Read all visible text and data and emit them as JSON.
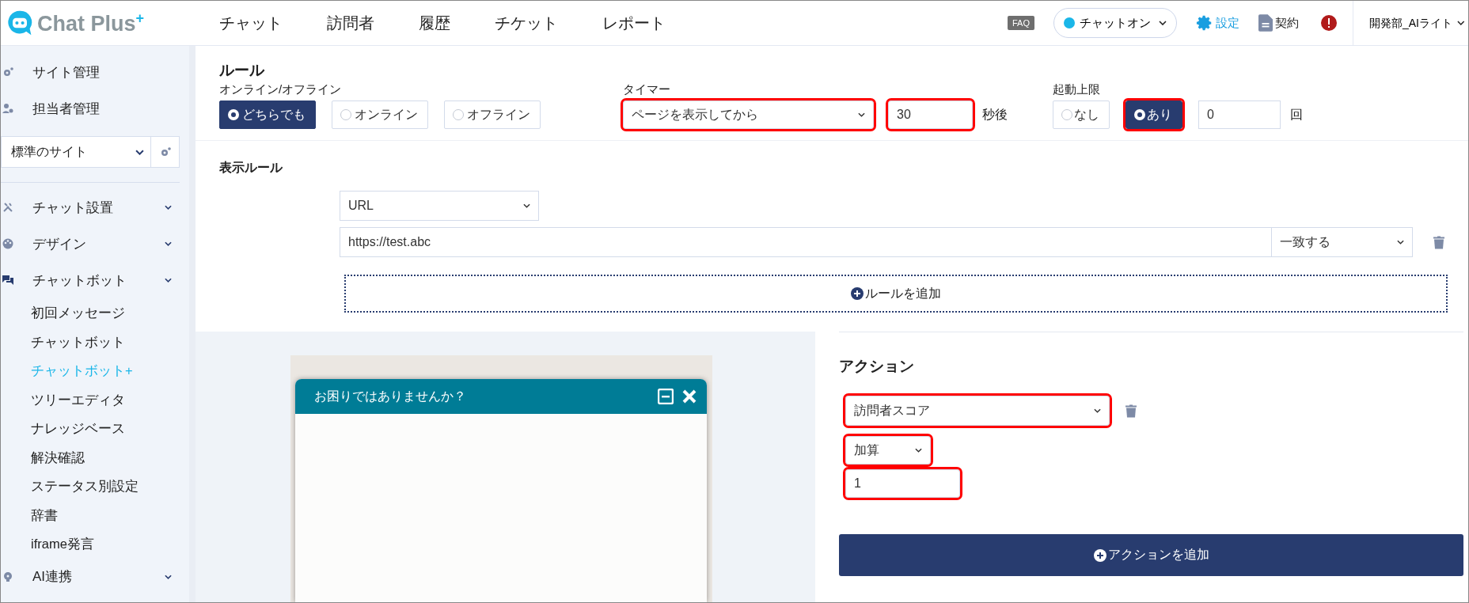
{
  "header": {
    "logo_text": "Chat Plus",
    "logo_mark": "+",
    "nav": [
      "チャット",
      "訪問者",
      "履歴",
      "チケット",
      "レポート"
    ],
    "faq": "FAQ",
    "status": "チャットオン",
    "settings": "設定",
    "contract": "契約",
    "account": "開発部_AIライト"
  },
  "sidebar": {
    "top_items": [
      {
        "label": "サイト管理"
      },
      {
        "label": "担当者管理"
      }
    ],
    "site_select": "標準のサイト",
    "menu": [
      {
        "label": "チャット設置"
      },
      {
        "label": "デザイン"
      },
      {
        "label": "チャットボット",
        "children": [
          {
            "label": "初回メッセージ",
            "selected": false
          },
          {
            "label": "チャットボット",
            "selected": false
          },
          {
            "label": "チャットボット+",
            "selected": true
          },
          {
            "label": "ツリーエディタ",
            "selected": false
          },
          {
            "label": "ナレッジベース",
            "selected": false
          },
          {
            "label": "解決確認",
            "selected": false
          },
          {
            "label": "ステータス別設定",
            "selected": false
          },
          {
            "label": "辞書",
            "selected": false
          },
          {
            "label": "iframe発言",
            "selected": false
          }
        ]
      },
      {
        "label": "AI連携"
      }
    ]
  },
  "rule": {
    "title": "ルール",
    "online_label": "オンライン/オフライン",
    "online_options": [
      {
        "label": "どちらでも",
        "selected": true
      },
      {
        "label": "オンライン",
        "selected": false
      },
      {
        "label": "オフライン",
        "selected": false
      }
    ],
    "timer_label": "タイマー",
    "timer_select": {
      "value": "ページを表示してから",
      "highlighted": true
    },
    "timer_seconds": {
      "value": "30",
      "highlighted": true
    },
    "seconds_unit": "秒後",
    "limit_label": "起動上限",
    "limit_options": [
      {
        "label": "なし",
        "selected": false,
        "highlighted": false
      },
      {
        "label": "あり",
        "selected": true,
        "highlighted": true
      }
    ],
    "limit_count": "0",
    "count_unit": "回"
  },
  "display_rule": {
    "title": "表示ルール",
    "type_select": "URL",
    "url": "https://test.abc",
    "match_select": "一致する",
    "add_button": "ルールを追加"
  },
  "preview": {
    "title": "お困りではありませんか？"
  },
  "action": {
    "title": "アクション",
    "action_select": {
      "value": "訪問者スコア",
      "highlighted": true
    },
    "operation_select": {
      "value": "加算",
      "highlighted": true
    },
    "amount": {
      "value": "1",
      "highlighted": true
    },
    "add_button": "アクションを追加"
  }
}
